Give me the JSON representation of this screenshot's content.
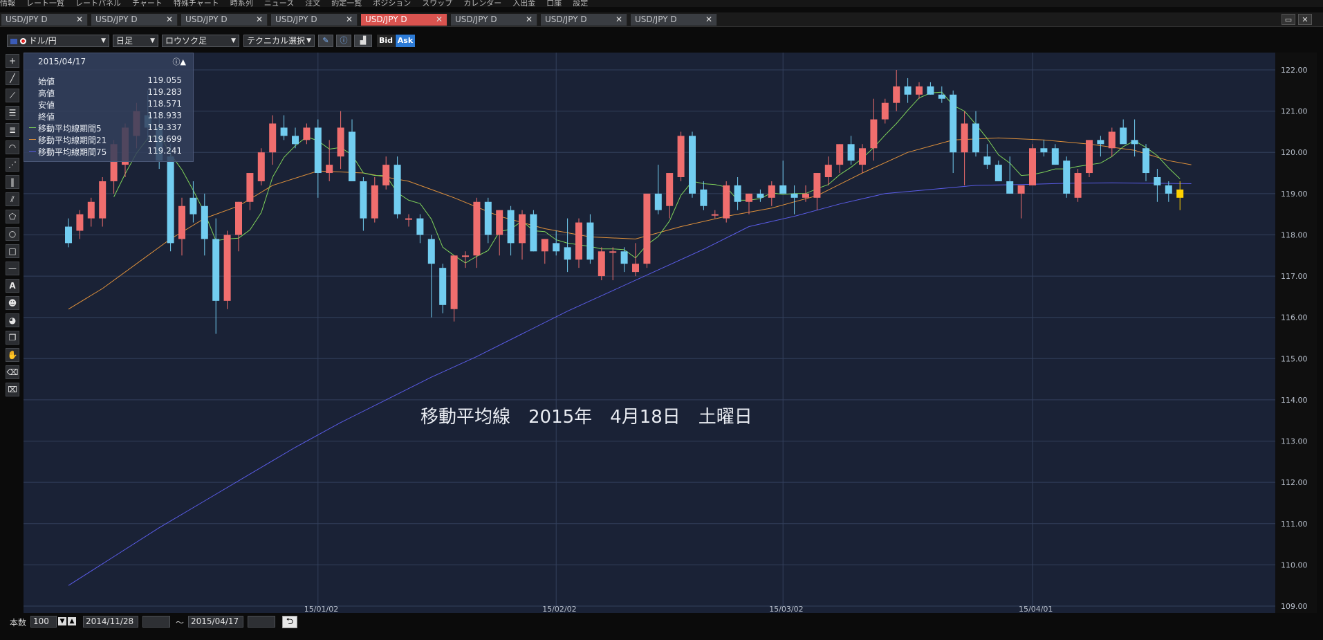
{
  "menu": {
    "items": [
      "情報",
      "レート一覧",
      "レートパネル",
      "チャート",
      "特殊チャート",
      "時系列",
      "ニュース",
      "注文",
      "約定一覧",
      "ポジション",
      "スワップ",
      "カレンダー",
      "入出金",
      "口座",
      "設定"
    ],
    "right_label": "設定"
  },
  "tabs": [
    {
      "label": "USD/JPY D",
      "active": false
    },
    {
      "label": "USD/JPY D",
      "active": false
    },
    {
      "label": "USD/JPY D",
      "active": false
    },
    {
      "label": "USD/JPY D",
      "active": false
    },
    {
      "label": "USD/JPY D",
      "active": true
    },
    {
      "label": "USD/JPY D",
      "active": false
    },
    {
      "label": "USD/JPY D",
      "active": false
    },
    {
      "label": "USD/JPY D",
      "active": false
    }
  ],
  "toolbar": {
    "pair": "ドル/円",
    "timeframe": "日足",
    "chart_type": "ロウソク足",
    "technical": "テクニカル選択",
    "bid": "Bid",
    "ask": "Ask"
  },
  "info": {
    "date": "2015/04/17",
    "rows": [
      {
        "label": "始値",
        "value": "119.055",
        "color": ""
      },
      {
        "label": "高値",
        "value": "119.283",
        "color": ""
      },
      {
        "label": "安値",
        "value": "118.571",
        "color": ""
      },
      {
        "label": "終値",
        "value": "118.933",
        "color": ""
      },
      {
        "label": "移動平均線期間5",
        "value": "119.337",
        "color": "#7fd35a"
      },
      {
        "label": "移動平均線期間21",
        "value": "119.699",
        "color": "#e0913b"
      },
      {
        "label": "移動平均線期間75",
        "value": "119.241",
        "color": "#5a5ce8"
      }
    ]
  },
  "overlay_text": "移動平均線　2015年　4月18日　土曜日",
  "bottom": {
    "count_label": "本数",
    "count_value": "100",
    "from_date": "2014/11/28",
    "tilde": "～",
    "to_date": "2015/04/17"
  },
  "colors": {
    "up": "#f06e6e",
    "down": "#72cdf0",
    "ma5": "#7fd35a",
    "ma21": "#e0913b",
    "ma75": "#5a5ce8",
    "plot_bg": "#1a2236",
    "last": "#ffd200"
  },
  "chart_data": {
    "type": "candlestick",
    "y_ticks": [
      "122.00",
      "121.00",
      "120.00",
      "119.00",
      "118.00",
      "117.00",
      "116.00",
      "115.00",
      "114.00",
      "113.00",
      "112.00",
      "111.00",
      "110.00",
      "109.00"
    ],
    "ylim": [
      109,
      122
    ],
    "x_ticks": [
      {
        "i": 22,
        "label": "15/01/02"
      },
      {
        "i": 43,
        "label": "15/02/02"
      },
      {
        "i": 63,
        "label": "15/03/02"
      },
      {
        "i": 85,
        "label": "15/04/01"
      }
    ],
    "ohlc": [
      [
        118.2,
        118.4,
        117.7,
        117.8
      ],
      [
        118.1,
        118.6,
        117.9,
        118.5
      ],
      [
        118.4,
        118.9,
        118.2,
        118.8
      ],
      [
        118.4,
        119.4,
        118.2,
        119.3
      ],
      [
        119.3,
        120.3,
        119.0,
        120.2
      ],
      [
        119.7,
        120.7,
        119.4,
        120.6
      ],
      [
        120.4,
        121.2,
        120.1,
        121.0
      ],
      [
        120.9,
        121.5,
        120.3,
        120.6
      ],
      [
        120.6,
        121.0,
        119.6,
        119.8
      ],
      [
        119.9,
        120.2,
        117.6,
        117.8
      ],
      [
        117.9,
        118.9,
        117.5,
        118.7
      ],
      [
        118.9,
        119.3,
        118.3,
        118.5
      ],
      [
        118.7,
        119.0,
        117.5,
        117.9
      ],
      [
        117.9,
        118.4,
        115.6,
        116.4
      ],
      [
        116.4,
        118.1,
        116.2,
        118.0
      ],
      [
        118.0,
        118.8,
        117.6,
        118.8
      ],
      [
        118.8,
        119.5,
        118.6,
        119.5
      ],
      [
        119.3,
        120.1,
        119.2,
        120.0
      ],
      [
        120.0,
        120.9,
        119.7,
        120.7
      ],
      [
        120.6,
        120.9,
        120.3,
        120.4
      ],
      [
        120.4,
        120.6,
        120.1,
        120.2
      ],
      [
        120.3,
        120.7,
        120.2,
        120.6
      ],
      [
        120.6,
        120.8,
        118.9,
        119.5
      ],
      [
        119.5,
        120.3,
        119.3,
        119.7
      ],
      [
        119.9,
        121.0,
        119.6,
        120.6
      ],
      [
        120.5,
        120.8,
        119.4,
        119.3
      ],
      [
        119.3,
        119.4,
        118.1,
        118.4
      ],
      [
        118.4,
        119.4,
        118.3,
        119.2
      ],
      [
        119.2,
        119.9,
        119.1,
        119.7
      ],
      [
        119.7,
        119.9,
        118.4,
        118.5
      ],
      [
        118.4,
        118.5,
        118.2,
        118.4
      ],
      [
        118.4,
        118.5,
        117.8,
        118.0
      ],
      [
        117.9,
        118.0,
        116.0,
        117.3
      ],
      [
        117.2,
        117.3,
        116.1,
        116.3
      ],
      [
        116.2,
        117.5,
        115.9,
        117.5
      ],
      [
        117.5,
        117.6,
        117.2,
        117.5
      ],
      [
        117.5,
        118.9,
        117.2,
        118.8
      ],
      [
        118.8,
        118.9,
        117.8,
        118.0
      ],
      [
        118.0,
        118.6,
        117.5,
        118.6
      ],
      [
        118.6,
        118.7,
        117.5,
        117.8
      ],
      [
        117.8,
        118.6,
        117.4,
        118.5
      ],
      [
        118.5,
        118.6,
        117.6,
        117.6
      ],
      [
        117.6,
        117.9,
        117.3,
        117.9
      ],
      [
        117.8,
        118.1,
        117.5,
        117.6
      ],
      [
        117.7,
        118.4,
        117.1,
        117.4
      ],
      [
        117.4,
        118.4,
        117.2,
        118.3
      ],
      [
        118.3,
        118.5,
        117.3,
        117.4
      ],
      [
        117.0,
        117.7,
        116.9,
        117.6
      ],
      [
        117.6,
        117.7,
        116.9,
        117.6
      ],
      [
        117.6,
        117.7,
        117.1,
        117.3
      ],
      [
        117.1,
        117.8,
        117.0,
        117.3
      ],
      [
        117.3,
        118.8,
        117.2,
        119.0
      ],
      [
        119.0,
        119.7,
        118.5,
        118.6
      ],
      [
        118.7,
        119.5,
        118.4,
        119.5
      ],
      [
        119.4,
        120.5,
        119.3,
        120.4
      ],
      [
        120.4,
        120.5,
        118.9,
        119.0
      ],
      [
        119.1,
        119.3,
        118.6,
        118.7
      ],
      [
        118.5,
        118.6,
        118.4,
        118.5
      ],
      [
        118.4,
        119.3,
        118.3,
        119.2
      ],
      [
        119.2,
        119.4,
        118.6,
        118.8
      ],
      [
        118.8,
        119.0,
        118.5,
        119.0
      ],
      [
        119.0,
        119.1,
        118.8,
        118.9
      ],
      [
        118.9,
        119.3,
        118.7,
        119.2
      ],
      [
        119.2,
        119.8,
        119.0,
        119.0
      ],
      [
        119.0,
        119.2,
        118.5,
        118.9
      ],
      [
        118.9,
        119.2,
        118.8,
        119.0
      ],
      [
        118.9,
        119.5,
        118.6,
        119.5
      ],
      [
        119.4,
        119.9,
        119.2,
        119.7
      ],
      [
        119.7,
        120.2,
        119.5,
        120.2
      ],
      [
        120.2,
        120.4,
        119.7,
        119.8
      ],
      [
        119.7,
        120.2,
        119.5,
        120.1
      ],
      [
        120.1,
        121.3,
        119.8,
        120.8
      ],
      [
        120.8,
        121.3,
        120.7,
        121.2
      ],
      [
        121.2,
        122.0,
        121.0,
        121.6
      ],
      [
        121.6,
        121.8,
        121.2,
        121.4
      ],
      [
        121.4,
        121.7,
        121.3,
        121.6
      ],
      [
        121.6,
        121.7,
        121.4,
        121.4
      ],
      [
        121.4,
        121.6,
        121.2,
        121.3
      ],
      [
        121.4,
        121.5,
        119.5,
        120.0
      ],
      [
        120.0,
        121.0,
        119.2,
        120.7
      ],
      [
        120.7,
        121.0,
        119.9,
        120.0
      ],
      [
        119.9,
        120.2,
        119.6,
        119.7
      ],
      [
        119.7,
        119.8,
        119.3,
        119.3
      ],
      [
        119.3,
        119.9,
        119.0,
        119.0
      ],
      [
        119.0,
        119.1,
        118.4,
        119.2
      ],
      [
        119.2,
        120.2,
        119.2,
        120.1
      ],
      [
        120.1,
        120.3,
        119.9,
        120.0
      ],
      [
        120.1,
        120.2,
        119.7,
        119.7
      ],
      [
        119.8,
        119.9,
        118.9,
        119.0
      ],
      [
        118.9,
        119.6,
        118.8,
        119.5
      ],
      [
        119.5,
        120.3,
        119.4,
        120.3
      ],
      [
        120.3,
        120.4,
        119.9,
        120.2
      ],
      [
        120.1,
        120.6,
        119.9,
        120.5
      ],
      [
        120.6,
        120.8,
        120.3,
        120.2
      ],
      [
        120.3,
        120.8,
        119.9,
        120.2
      ],
      [
        120.1,
        120.2,
        119.3,
        119.5
      ],
      [
        119.4,
        119.6,
        118.8,
        119.2
      ],
      [
        119.2,
        119.3,
        118.8,
        119.0
      ],
      [
        119.1,
        119.3,
        118.6,
        118.9
      ]
    ],
    "ma75": [
      [
        0,
        109.5
      ],
      [
        4,
        110.2
      ],
      [
        8,
        110.9
      ],
      [
        12,
        111.55
      ],
      [
        16,
        112.2
      ],
      [
        20,
        112.85
      ],
      [
        24,
        113.45
      ],
      [
        28,
        114.0
      ],
      [
        32,
        114.55
      ],
      [
        36,
        115.05
      ],
      [
        40,
        115.6
      ],
      [
        44,
        116.15
      ],
      [
        48,
        116.65
      ],
      [
        52,
        117.15
      ],
      [
        56,
        117.65
      ],
      [
        60,
        118.2
      ],
      [
        64,
        118.45
      ],
      [
        68,
        118.75
      ],
      [
        72,
        119.0
      ],
      [
        76,
        119.1
      ],
      [
        80,
        119.2
      ],
      [
        84,
        119.22
      ],
      [
        88,
        119.25
      ],
      [
        92,
        119.26
      ],
      [
        96,
        119.25
      ],
      [
        99,
        119.24
      ]
    ],
    "ma21": [
      [
        0,
        116.2
      ],
      [
        3,
        116.7
      ],
      [
        6,
        117.3
      ],
      [
        9,
        117.9
      ],
      [
        12,
        118.4
      ],
      [
        15,
        118.7
      ],
      [
        18,
        119.2
      ],
      [
        22,
        119.55
      ],
      [
        26,
        119.5
      ],
      [
        30,
        119.3
      ],
      [
        34,
        118.9
      ],
      [
        38,
        118.45
      ],
      [
        42,
        118.15
      ],
      [
        46,
        117.95
      ],
      [
        50,
        117.9
      ],
      [
        54,
        118.2
      ],
      [
        58,
        118.45
      ],
      [
        62,
        118.65
      ],
      [
        66,
        118.95
      ],
      [
        70,
        119.5
      ],
      [
        74,
        120.0
      ],
      [
        78,
        120.3
      ],
      [
        82,
        120.35
      ],
      [
        86,
        120.3
      ],
      [
        90,
        120.2
      ],
      [
        94,
        120.05
      ],
      [
        97,
        119.8
      ],
      [
        99,
        119.7
      ]
    ]
  }
}
